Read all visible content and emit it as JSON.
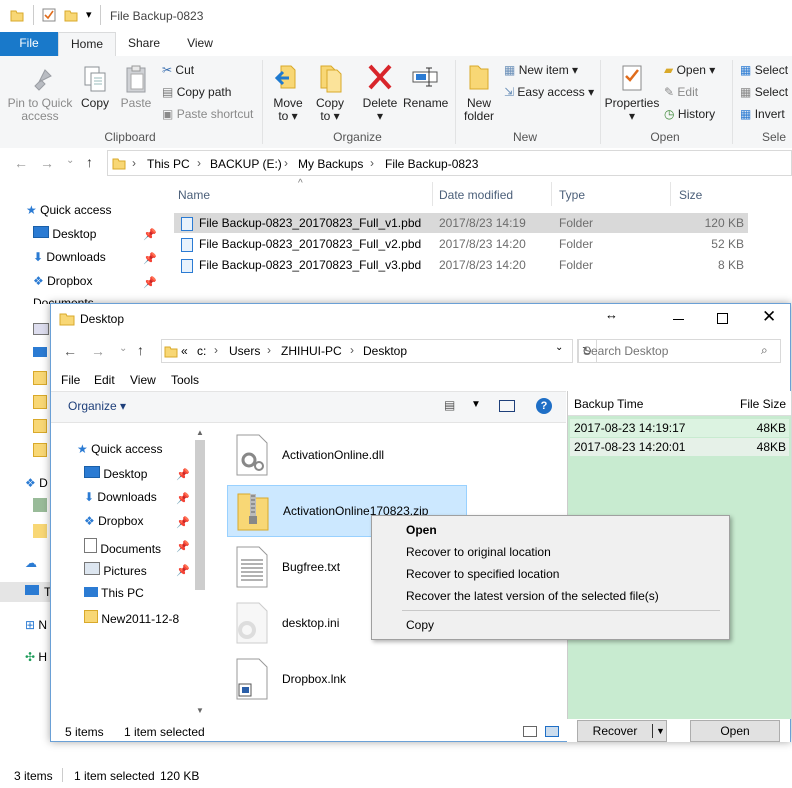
{
  "explorer": {
    "title": "File Backup-0823",
    "tabs": [
      "File",
      "Home",
      "Share",
      "View"
    ],
    "ribbon": {
      "clipboard": {
        "pin_label": [
          "Pin to Quick",
          "access"
        ],
        "copy": "Copy",
        "paste": "Paste",
        "cut": "Cut",
        "copy_path": "Copy path",
        "paste_shortcut": "Paste shortcut",
        "group": "Clipboard"
      },
      "organize": {
        "move_to": [
          "Move",
          "to ▾"
        ],
        "copy_to": [
          "Copy",
          "to ▾"
        ],
        "delete": [
          "Delete",
          "▾"
        ],
        "rename": "Rename",
        "group": "Organize"
      },
      "new": {
        "new_folder": [
          "New",
          "folder"
        ],
        "new_item": "New item ▾",
        "easy_access": "Easy access ▾",
        "group": "New"
      },
      "open": {
        "properties": [
          "Properties",
          "▾"
        ],
        "open": "Open ▾",
        "edit": "Edit",
        "history": "History",
        "group": "Open"
      },
      "select": {
        "select_all": "Select",
        "select_none": "Select",
        "invert": "Invert",
        "group": "Sele"
      }
    },
    "breadcrumb": [
      "This PC",
      "BACKUP (E:)",
      "My Backups",
      "File Backup-0823"
    ],
    "nav": {
      "quick_access": "Quick access",
      "items": [
        "Desktop",
        "Downloads",
        "Dropbox",
        "Documents"
      ],
      "partial": [
        "D",
        "T",
        "N",
        "H"
      ]
    },
    "columns": [
      "Name",
      "Date modified",
      "Type",
      "Size"
    ],
    "files": [
      {
        "name": "File Backup-0823_20170823_Full_v1.pbd",
        "date": "2017/8/23 14:19",
        "type": "Folder",
        "size": "120 KB"
      },
      {
        "name": "File Backup-0823_20170823_Full_v2.pbd",
        "date": "2017/8/23 14:20",
        "type": "Folder",
        "size": "52 KB"
      },
      {
        "name": "File Backup-0823_20170823_Full_v3.pbd",
        "date": "2017/8/23 14:20",
        "type": "Folder",
        "size": "8 KB"
      }
    ],
    "status": {
      "count": "3 items",
      "selected": "1 item selected",
      "size": "120 KB"
    }
  },
  "dialog": {
    "title": "Desktop",
    "breadcrumb": [
      "«",
      "c:",
      "Users",
      "ZHIHUI-PC",
      "Desktop"
    ],
    "search_placeholder": "Search Desktop",
    "menu": [
      "File",
      "Edit",
      "View",
      "Tools"
    ],
    "organize": "Organize ▾",
    "nav": {
      "quick_access": "Quick access",
      "items": [
        "Desktop",
        "Downloads",
        "Dropbox",
        "Documents",
        "Pictures",
        "This PC",
        "New2011-12-8"
      ]
    },
    "files": [
      "ActivationOnline.dll",
      "ActivationOnline170823.zip",
      "Bugfree.txt",
      "desktop.ini",
      "Dropbox.lnk"
    ],
    "status": {
      "count": "5 items",
      "selected": "1 item selected"
    },
    "versions": {
      "headers": [
        "Backup Time",
        "File Size"
      ],
      "rows": [
        {
          "time": "2017-08-23 14:19:17",
          "size": "48KB"
        },
        {
          "time": "2017-08-23 14:20:01",
          "size": "48KB"
        }
      ]
    },
    "buttons": {
      "recover": "Recover",
      "open": "Open"
    }
  },
  "context_menu": {
    "items": [
      "Open",
      "Recover to original location",
      "Recover to specified location",
      "Recover the latest version of the selected file(s)",
      "Copy"
    ]
  }
}
